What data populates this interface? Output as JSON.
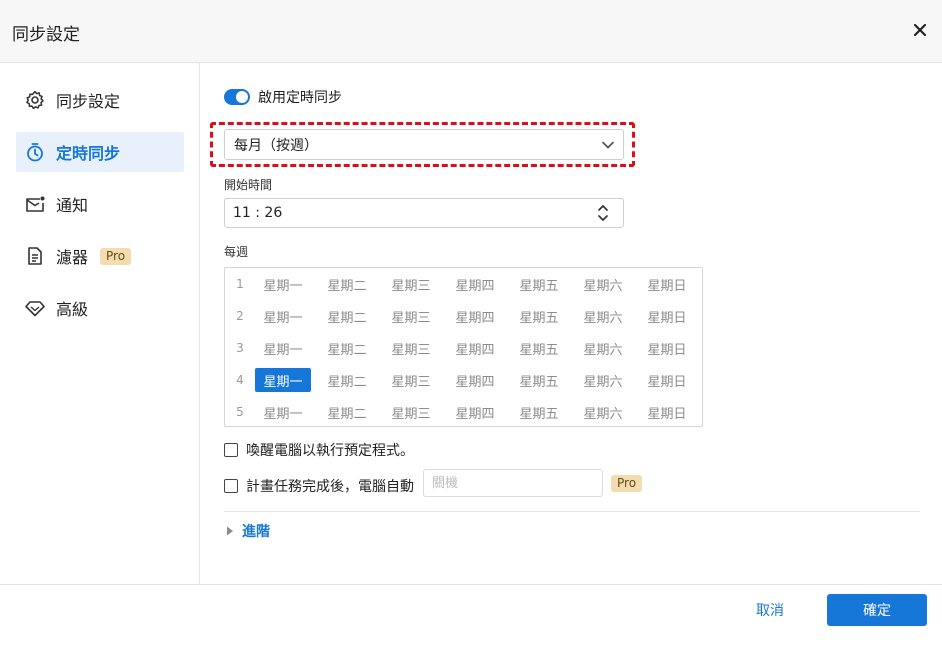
{
  "header": {
    "title": "同步設定",
    "close_icon": "close-icon"
  },
  "sidebar": {
    "items": [
      {
        "label": "同步設定",
        "icon": "gear-icon",
        "active": false
      },
      {
        "label": "定時同步",
        "icon": "stopwatch-icon",
        "active": true
      },
      {
        "label": "通知",
        "icon": "mail-icon",
        "active": false
      },
      {
        "label": "濾器",
        "icon": "document-filter-icon",
        "active": false,
        "badge": "Pro"
      },
      {
        "label": "高級",
        "icon": "diamond-icon",
        "active": false
      }
    ]
  },
  "main": {
    "toggle_label": "啟用定時同步",
    "toggle_on": true,
    "schedule_select": {
      "value": "每月（按週）"
    },
    "start_time_label": "開始時間",
    "start_time_value": "11 : 26",
    "weekly_label": "每週",
    "week_days": [
      "星期一",
      "星期二",
      "星期三",
      "星期四",
      "星期五",
      "星期六",
      "星期日"
    ],
    "week_rows": [
      {
        "num": "1",
        "selected": []
      },
      {
        "num": "2",
        "selected": []
      },
      {
        "num": "3",
        "selected": []
      },
      {
        "num": "4",
        "selected": [
          0
        ]
      },
      {
        "num": "5",
        "selected": []
      }
    ],
    "wake_label": "喚醒電腦以執行預定程式。",
    "after_task_label": "計畫任務完成後，電腦自動",
    "after_task_placeholder": "關機",
    "after_task_badge": "Pro",
    "advanced_label": "進階"
  },
  "footer": {
    "cancel_label": "取消",
    "ok_label": "確定"
  },
  "colors": {
    "accent": "#1677d8",
    "highlight_frame": "#d9101b",
    "pro_badge_bg": "#f3dcb0"
  }
}
